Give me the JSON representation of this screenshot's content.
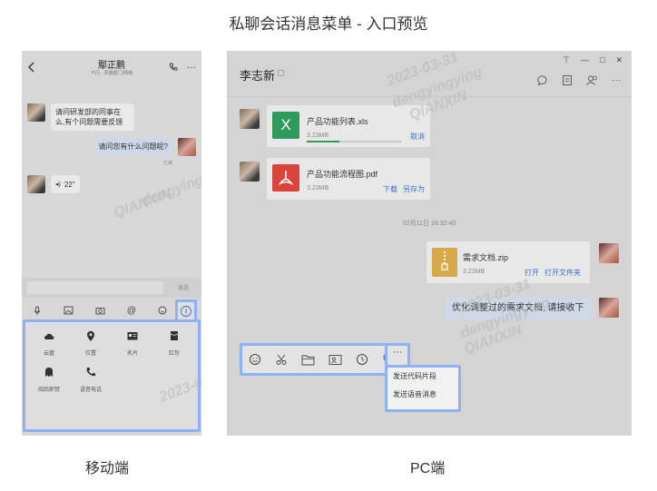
{
  "page_title": "私聊会话消息菜单 - 入口预览",
  "captions": {
    "mobile": "移动端",
    "pc": "PC端"
  },
  "mobile": {
    "contact_name": "鄢正鹏",
    "contact_subtitle": "下行、机器部门/网络",
    "messages": [
      {
        "from": "them",
        "text": "请问研发部的同事在么,有个问题需要反馈"
      },
      {
        "from": "me",
        "text": "请问您有什么问题呢?"
      },
      {
        "from": "them",
        "text": "22\""
      }
    ],
    "read_receipt": "已读",
    "send_label": "发送",
    "panel_items": [
      {
        "icon": "cloud-icon",
        "label": "云盘"
      },
      {
        "icon": "location-icon",
        "label": "位置"
      },
      {
        "icon": "contact-card-icon",
        "label": "名片"
      },
      {
        "icon": "red-packet-icon",
        "label": "红包"
      },
      {
        "icon": "burn-after-read-icon",
        "label": "阅后即焚"
      },
      {
        "icon": "voice-call-icon",
        "label": "语音电话"
      }
    ]
  },
  "pc": {
    "contact_name": "李志新",
    "window_controls": [
      "pin",
      "minimize",
      "maximize",
      "close"
    ],
    "files": [
      {
        "name": "产品功能列表.xls",
        "size": "3.23MB",
        "type": "X",
        "action1": "取消",
        "progress": 0.35
      },
      {
        "name": "产品功能流程图.pdf",
        "size": "3.23MB",
        "type": "pdf",
        "action1": "下载",
        "action2": "另存为"
      }
    ],
    "timestamp": "02月11日 16:32:40",
    "my_file": {
      "name": "需求文档.zip",
      "size": "3.23MB",
      "action1": "打开",
      "action2": "打开文件夹"
    },
    "my_message": "优化调整过的需求文档, 请接收下",
    "more_menu": [
      "发送代码片段",
      "发送语音消息"
    ]
  },
  "watermark": {
    "line1": "2023-03-31",
    "line2": "dengyingying",
    "line3": "QIANXIN"
  },
  "colors": {
    "highlight": "#8fb0f5",
    "link": "#3e6fcf",
    "excel": "#2e9b5d",
    "pdf": "#d9453d",
    "zip": "#d6a94a"
  }
}
